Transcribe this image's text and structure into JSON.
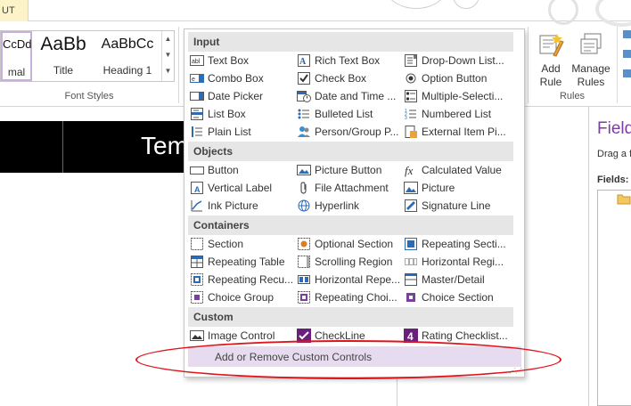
{
  "ribbon": {
    "partial_tab_label": "UT",
    "styles": [
      {
        "sample": "CcDd",
        "name": "mal"
      },
      {
        "sample": "AaBb",
        "name": "Title"
      },
      {
        "sample": "AaBbCc",
        "name": "Heading 1"
      }
    ],
    "font_styles_group": "Font Styles",
    "add_rule": "Add Rule",
    "manage_rules": "Manage Rules",
    "rules_group": "Rules"
  },
  "canvas": {
    "partial_title": "Tem"
  },
  "fields_pane": {
    "title": "Field",
    "description": "Drag a f",
    "fields_label": "Fields:"
  },
  "controls": {
    "categories": [
      {
        "name": "Input",
        "items": [
          {
            "label": "Text Box",
            "icon": "text-box-icon"
          },
          {
            "label": "Rich Text Box",
            "icon": "rich-text-box-icon"
          },
          {
            "label": "Drop-Down List...",
            "icon": "drop-down-list-icon"
          },
          {
            "label": "Combo Box",
            "icon": "combo-box-icon"
          },
          {
            "label": "Check Box",
            "icon": "check-box-icon"
          },
          {
            "label": "Option Button",
            "icon": "option-button-icon"
          },
          {
            "label": "Date Picker",
            "icon": "date-picker-icon"
          },
          {
            "label": "Date and Time ...",
            "icon": "date-time-icon"
          },
          {
            "label": "Multiple-Selecti...",
            "icon": "multiple-selection-icon"
          },
          {
            "label": "List Box",
            "icon": "list-box-icon"
          },
          {
            "label": "Bulleted List",
            "icon": "bulleted-list-icon"
          },
          {
            "label": "Numbered List",
            "icon": "numbered-list-icon"
          },
          {
            "label": "Plain List",
            "icon": "plain-list-icon"
          },
          {
            "label": "Person/Group P...",
            "icon": "person-group-icon"
          },
          {
            "label": "External Item Pi...",
            "icon": "external-item-icon"
          }
        ]
      },
      {
        "name": "Objects",
        "items": [
          {
            "label": "Button",
            "icon": "button-icon"
          },
          {
            "label": "Picture Button",
            "icon": "picture-button-icon"
          },
          {
            "label": "Calculated Value",
            "icon": "calculated-value-icon"
          },
          {
            "label": "Vertical Label",
            "icon": "vertical-label-icon"
          },
          {
            "label": "File Attachment",
            "icon": "file-attachment-icon"
          },
          {
            "label": "Picture",
            "icon": "picture-icon"
          },
          {
            "label": "Ink Picture",
            "icon": "ink-picture-icon"
          },
          {
            "label": "Hyperlink",
            "icon": "hyperlink-icon"
          },
          {
            "label": "Signature Line",
            "icon": "signature-line-icon"
          }
        ]
      },
      {
        "name": "Containers",
        "items": [
          {
            "label": "Section",
            "icon": "section-icon"
          },
          {
            "label": "Optional Section",
            "icon": "optional-section-icon"
          },
          {
            "label": "Repeating Secti...",
            "icon": "repeating-section-icon"
          },
          {
            "label": "Repeating Table",
            "icon": "repeating-table-icon"
          },
          {
            "label": "Scrolling Region",
            "icon": "scrolling-region-icon"
          },
          {
            "label": "Horizontal Regi...",
            "icon": "horizontal-region-icon"
          },
          {
            "label": "Repeating Recu...",
            "icon": "repeating-recursive-icon"
          },
          {
            "label": "Horizontal Repe...",
            "icon": "horizontal-repeating-icon"
          },
          {
            "label": "Master/Detail",
            "icon": "master-detail-icon"
          },
          {
            "label": "Choice Group",
            "icon": "choice-group-icon"
          },
          {
            "label": "Repeating Choi...",
            "icon": "repeating-choice-icon"
          },
          {
            "label": "Choice Section",
            "icon": "choice-section-icon"
          }
        ]
      },
      {
        "name": "Custom",
        "items": [
          {
            "label": "Image Control",
            "icon": "image-control-icon"
          },
          {
            "label": "CheckLine",
            "icon": "checkline-icon"
          },
          {
            "label": "Rating Checklist...",
            "icon": "rating-checklist-icon"
          }
        ]
      }
    ],
    "add_remove_label": "Add or Remove Custom Controls"
  },
  "colors": {
    "accent_purple": "#7a3f9f",
    "highlight_row": "#e7dcef",
    "annotation_red": "#e0141c",
    "layout_tab": "#fdf3c8"
  }
}
